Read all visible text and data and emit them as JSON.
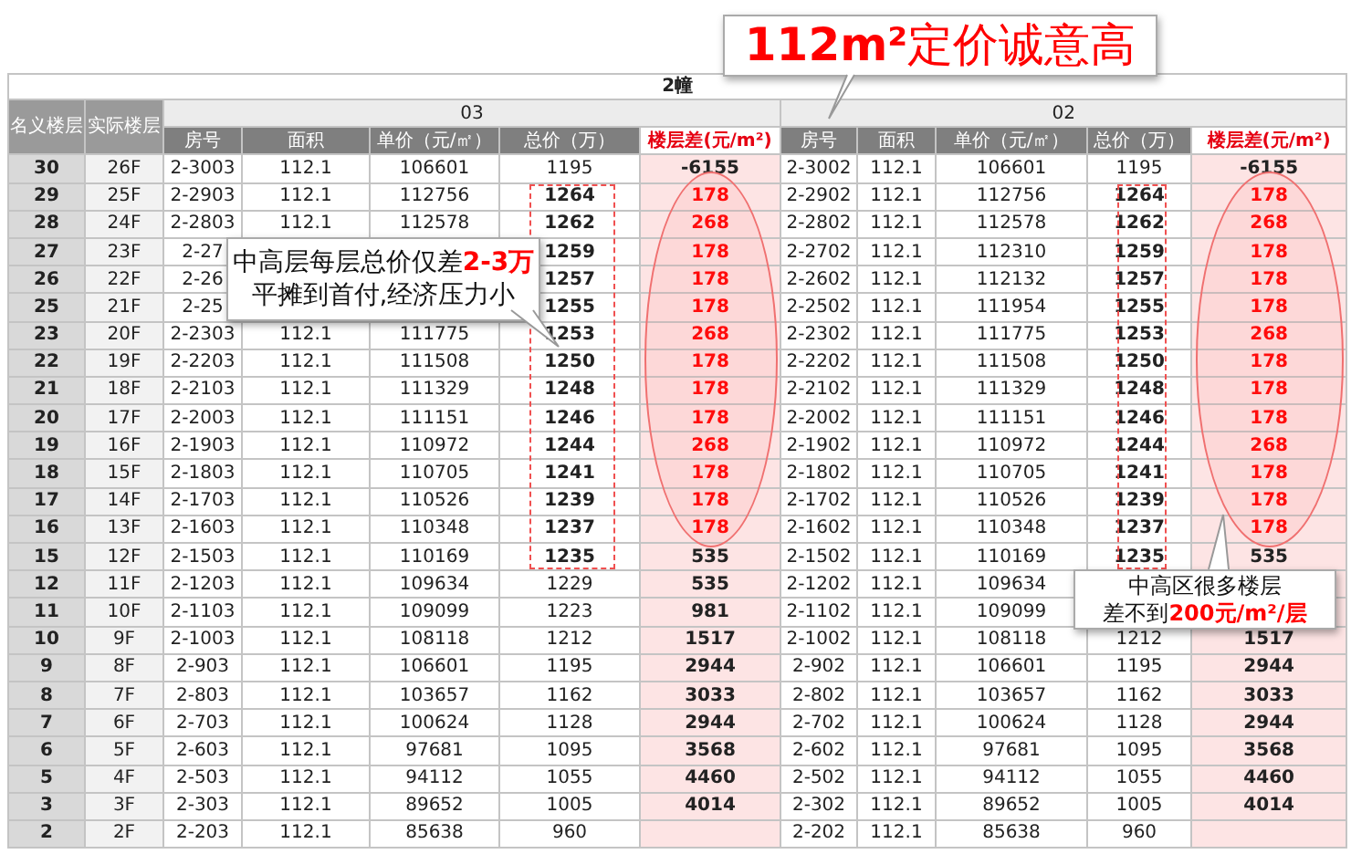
{
  "callouts": [
    {
      "lines": [
        "**112m²**定价诚意高"
      ]
    },
    {
      "lines": [
        "中高层每层总价仅差**2-3万**",
        "平摊到首付,经济压力小"
      ]
    },
    {
      "lines": [
        "中高区很多楼层",
        "差不到**200元/m²/层**"
      ]
    }
  ],
  "table": {
    "title": "2幢",
    "row_headers": [
      "名义楼层",
      "实际楼层"
    ],
    "units": [
      {
        "label": "03",
        "columns": [
          "房号",
          "面积",
          "单价（元/㎡）",
          "总价（万）",
          "楼层差(元/m²)"
        ]
      },
      {
        "label": "02",
        "columns": [
          "房号",
          "面积",
          "单价（元/㎡）",
          "总价（万）",
          "楼层差(元/m²)"
        ]
      }
    ],
    "rows": [
      {
        "nominal": "30",
        "actual": "26F",
        "units": [
          {
            "room": "2-3003",
            "area": "112.1",
            "unit_price": "106601",
            "total": "1195",
            "total_framed": false,
            "diff": "-6155",
            "diff_highlighted": false
          },
          {
            "room": "2-3002",
            "area": "112.1",
            "unit_price": "106601",
            "total": "1195",
            "total_framed": false,
            "diff": "-6155",
            "diff_highlighted": false
          }
        ]
      },
      {
        "nominal": "29",
        "actual": "25F",
        "units": [
          {
            "room": "2-2903",
            "area": "112.1",
            "unit_price": "112756",
            "total": "1264",
            "total_framed": true,
            "diff": "178",
            "diff_highlighted": true
          },
          {
            "room": "2-2902",
            "area": "112.1",
            "unit_price": "112756",
            "total": "1264",
            "total_framed": true,
            "diff": "178",
            "diff_highlighted": true
          }
        ]
      },
      {
        "nominal": "28",
        "actual": "24F",
        "units": [
          {
            "room": "2-2803",
            "area": "112.1",
            "unit_price": "112578",
            "total": "1262",
            "total_framed": true,
            "diff": "268",
            "diff_highlighted": true
          },
          {
            "room": "2-2802",
            "area": "112.1",
            "unit_price": "112578",
            "total": "1262",
            "total_framed": true,
            "diff": "268",
            "diff_highlighted": true
          }
        ]
      },
      {
        "nominal": "27",
        "actual": "23F",
        "units": [
          {
            "room": "2-27",
            "total": "1259",
            "total_framed": true,
            "diff": "178",
            "diff_highlighted": true
          },
          {
            "room": "2-2702",
            "area": "112.1",
            "unit_price": "112310",
            "total": "1259",
            "total_framed": true,
            "diff": "178",
            "diff_highlighted": true
          }
        ]
      },
      {
        "nominal": "26",
        "actual": "22F",
        "units": [
          {
            "room": "2-26",
            "total": "1257",
            "total_framed": true,
            "diff": "178",
            "diff_highlighted": true
          },
          {
            "room": "2-2602",
            "area": "112.1",
            "unit_price": "112132",
            "total": "1257",
            "total_framed": true,
            "diff": "178",
            "diff_highlighted": true
          }
        ]
      },
      {
        "nominal": "25",
        "actual": "21F",
        "units": [
          {
            "room": "2-25",
            "total": "1255",
            "total_framed": true,
            "diff": "178",
            "diff_highlighted": true
          },
          {
            "room": "2-2502",
            "area": "112.1",
            "unit_price": "111954",
            "total": "1255",
            "total_framed": true,
            "diff": "178",
            "diff_highlighted": true
          }
        ]
      },
      {
        "nominal": "23",
        "actual": "20F",
        "units": [
          {
            "room": "2-2303",
            "area": "112.1",
            "unit_price": "111775",
            "total": "1253",
            "total_framed": true,
            "diff": "268",
            "diff_highlighted": true
          },
          {
            "room": "2-2302",
            "area": "112.1",
            "unit_price": "111775",
            "total": "1253",
            "total_framed": true,
            "diff": "268",
            "diff_highlighted": true
          }
        ]
      },
      {
        "nominal": "22",
        "actual": "19F",
        "units": [
          {
            "room": "2-2203",
            "area": "112.1",
            "unit_price": "111508",
            "total": "1250",
            "total_framed": true,
            "diff": "178",
            "diff_highlighted": true
          },
          {
            "room": "2-2202",
            "area": "112.1",
            "unit_price": "111508",
            "total": "1250",
            "total_framed": true,
            "diff": "178",
            "diff_highlighted": true
          }
        ]
      },
      {
        "nominal": "21",
        "actual": "18F",
        "units": [
          {
            "room": "2-2103",
            "area": "112.1",
            "unit_price": "111329",
            "total": "1248",
            "total_framed": true,
            "diff": "178",
            "diff_highlighted": true
          },
          {
            "room": "2-2102",
            "area": "112.1",
            "unit_price": "111329",
            "total": "1248",
            "total_framed": true,
            "diff": "178",
            "diff_highlighted": true
          }
        ]
      },
      {
        "nominal": "20",
        "actual": "17F",
        "units": [
          {
            "room": "2-2003",
            "area": "112.1",
            "unit_price": "111151",
            "total": "1246",
            "total_framed": true,
            "diff": "178",
            "diff_highlighted": true
          },
          {
            "room": "2-2002",
            "area": "112.1",
            "unit_price": "111151",
            "total": "1246",
            "total_framed": true,
            "diff": "178",
            "diff_highlighted": true
          }
        ]
      },
      {
        "nominal": "19",
        "actual": "16F",
        "units": [
          {
            "room": "2-1903",
            "area": "112.1",
            "unit_price": "110972",
            "total": "1244",
            "total_framed": true,
            "diff": "268",
            "diff_highlighted": true
          },
          {
            "room": "2-1902",
            "area": "112.1",
            "unit_price": "110972",
            "total": "1244",
            "total_framed": true,
            "diff": "268",
            "diff_highlighted": true
          }
        ]
      },
      {
        "nominal": "18",
        "actual": "15F",
        "units": [
          {
            "room": "2-1803",
            "area": "112.1",
            "unit_price": "110705",
            "total": "1241",
            "total_framed": true,
            "diff": "178",
            "diff_highlighted": true
          },
          {
            "room": "2-1802",
            "area": "112.1",
            "unit_price": "110705",
            "total": "1241",
            "total_framed": true,
            "diff": "178",
            "diff_highlighted": true
          }
        ]
      },
      {
        "nominal": "17",
        "actual": "14F",
        "units": [
          {
            "room": "2-1703",
            "area": "112.1",
            "unit_price": "110526",
            "total": "1239",
            "total_framed": true,
            "diff": "178",
            "diff_highlighted": true
          },
          {
            "room": "2-1702",
            "area": "112.1",
            "unit_price": "110526",
            "total": "1239",
            "total_framed": true,
            "diff": "178",
            "diff_highlighted": true
          }
        ]
      },
      {
        "nominal": "16",
        "actual": "13F",
        "units": [
          {
            "room": "2-1603",
            "area": "112.1",
            "unit_price": "110348",
            "total": "1237",
            "total_framed": true,
            "diff": "178",
            "diff_highlighted": true
          },
          {
            "room": "2-1602",
            "area": "112.1",
            "unit_price": "110348",
            "total": "1237",
            "total_framed": true,
            "diff": "178",
            "diff_highlighted": true
          }
        ]
      },
      {
        "nominal": "15",
        "actual": "12F",
        "units": [
          {
            "room": "2-1503",
            "area": "112.1",
            "unit_price": "110169",
            "total": "1235",
            "total_framed": true,
            "diff": "535",
            "diff_highlighted": false
          },
          {
            "room": "2-1502",
            "area": "112.1",
            "unit_price": "110169",
            "total": "1235",
            "total_framed": true,
            "diff": "535",
            "diff_highlighted": false
          }
        ]
      },
      {
        "nominal": "12",
        "actual": "11F",
        "units": [
          {
            "room": "2-1203",
            "area": "112.1",
            "unit_price": "109634",
            "total": "1229",
            "total_framed": false,
            "diff": "535",
            "diff_highlighted": false
          },
          {
            "room": "2-1202",
            "area": "112.1",
            "unit_price": "109634"
          }
        ]
      },
      {
        "nominal": "11",
        "actual": "10F",
        "units": [
          {
            "room": "2-1103",
            "area": "112.1",
            "unit_price": "109099",
            "total": "1223",
            "total_framed": false,
            "diff": "981",
            "diff_highlighted": false
          },
          {
            "room": "2-1102",
            "area": "112.1",
            "unit_price": "109099"
          }
        ]
      },
      {
        "nominal": "10",
        "actual": "9F",
        "units": [
          {
            "room": "2-1003",
            "area": "112.1",
            "unit_price": "108118",
            "total": "1212",
            "total_framed": false,
            "diff": "1517",
            "diff_highlighted": false
          },
          {
            "room": "2-1002",
            "area": "112.1",
            "unit_price": "108118",
            "total": "1212",
            "total_framed": false,
            "diff": "1517",
            "diff_highlighted": false
          }
        ]
      },
      {
        "nominal": "9",
        "actual": "8F",
        "units": [
          {
            "room": "2-903",
            "area": "112.1",
            "unit_price": "106601",
            "total": "1195",
            "total_framed": false,
            "diff": "2944",
            "diff_highlighted": false
          },
          {
            "room": "2-902",
            "area": "112.1",
            "unit_price": "106601",
            "total": "1195",
            "total_framed": false,
            "diff": "2944",
            "diff_highlighted": false
          }
        ]
      },
      {
        "nominal": "8",
        "actual": "7F",
        "units": [
          {
            "room": "2-803",
            "area": "112.1",
            "unit_price": "103657",
            "total": "1162",
            "total_framed": false,
            "diff": "3033",
            "diff_highlighted": false
          },
          {
            "room": "2-802",
            "area": "112.1",
            "unit_price": "103657",
            "total": "1162",
            "total_framed": false,
            "diff": "3033",
            "diff_highlighted": false
          }
        ]
      },
      {
        "nominal": "7",
        "actual": "6F",
        "units": [
          {
            "room": "2-703",
            "area": "112.1",
            "unit_price": "100624",
            "total": "1128",
            "total_framed": false,
            "diff": "2944",
            "diff_highlighted": false
          },
          {
            "room": "2-702",
            "area": "112.1",
            "unit_price": "100624",
            "total": "1128",
            "total_framed": false,
            "diff": "2944",
            "diff_highlighted": false
          }
        ]
      },
      {
        "nominal": "6",
        "actual": "5F",
        "units": [
          {
            "room": "2-603",
            "area": "112.1",
            "unit_price": "97681",
            "total": "1095",
            "total_framed": false,
            "diff": "3568",
            "diff_highlighted": false
          },
          {
            "room": "2-602",
            "area": "112.1",
            "unit_price": "97681",
            "total": "1095",
            "total_framed": false,
            "diff": "3568",
            "diff_highlighted": false
          }
        ]
      },
      {
        "nominal": "5",
        "actual": "4F",
        "units": [
          {
            "room": "2-503",
            "area": "112.1",
            "unit_price": "94112",
            "total": "1055",
            "total_framed": false,
            "diff": "4460",
            "diff_highlighted": false
          },
          {
            "room": "2-502",
            "area": "112.1",
            "unit_price": "94112",
            "total": "1055",
            "total_framed": false,
            "diff": "4460",
            "diff_highlighted": false
          }
        ]
      },
      {
        "nominal": "3",
        "actual": "3F",
        "units": [
          {
            "room": "2-303",
            "area": "112.1",
            "unit_price": "89652",
            "total": "1005",
            "total_framed": false,
            "diff": "4014",
            "diff_highlighted": false
          },
          {
            "room": "2-302",
            "area": "112.1",
            "unit_price": "89652",
            "total": "1005",
            "total_framed": false,
            "diff": "4014",
            "diff_highlighted": false
          }
        ]
      },
      {
        "nominal": "2",
        "actual": "2F",
        "units": [
          {
            "room": "2-203",
            "area": "112.1",
            "unit_price": "85638",
            "total": "960",
            "total_framed": false
          },
          {
            "room": "2-202",
            "area": "112.1",
            "unit_price": "85638",
            "total": "960",
            "total_framed": false
          }
        ]
      }
    ]
  }
}
